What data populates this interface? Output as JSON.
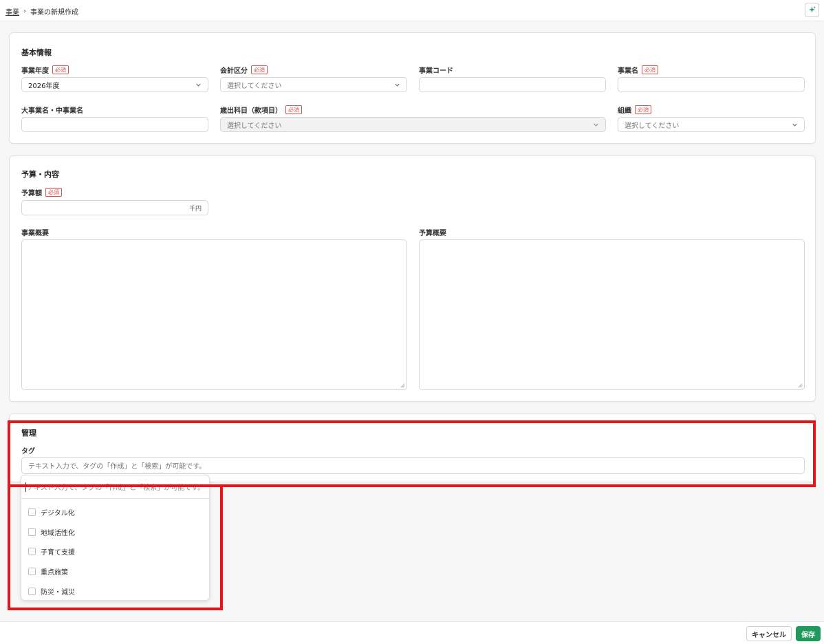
{
  "breadcrumb": {
    "parent": "事業",
    "current": "事業の新規作成"
  },
  "icons": {
    "ai": "sparkle-icon",
    "chevron": "chevron-down-icon",
    "resize": "resize-grip-icon"
  },
  "colors": {
    "required": "#d9534f",
    "save": "#1f9a5c",
    "highlight": "#e8141a"
  },
  "basic_info": {
    "title": "基本情報",
    "required_badge": "必須",
    "fiscal_year": {
      "label": "事業年度",
      "value": "2026年度"
    },
    "account_category": {
      "label": "会計区分",
      "placeholder": "選択してください"
    },
    "project_code": {
      "label": "事業コード",
      "value": ""
    },
    "project_name": {
      "label": "事業名",
      "value": ""
    },
    "major_minor_name": {
      "label": "大事業名・中事業名",
      "value": ""
    },
    "expenditure_item": {
      "label": "歳出科目（款項目）",
      "placeholder": "選択してください"
    },
    "organization": {
      "label": "組織",
      "placeholder": "選択してください"
    }
  },
  "budget": {
    "title": "予算・内容",
    "amount": {
      "label": "予算額",
      "unit": "千円",
      "value": ""
    },
    "project_summary": {
      "label": "事業概要",
      "value": ""
    },
    "budget_summary": {
      "label": "予算概要",
      "value": ""
    }
  },
  "management": {
    "title": "管理",
    "tag": {
      "label": "タグ",
      "placeholder": "テキスト入力で、タグの「作成」と「検索」が可能です。",
      "search_placeholder": "テキスト入力で、タグの「作成」と「検索」が可能です。",
      "options": [
        "デジタル化",
        "地域活性化",
        "子育て支援",
        "重点施策",
        "防災・減災"
      ]
    }
  },
  "footer": {
    "cancel": "キャンセル",
    "save": "保存"
  }
}
